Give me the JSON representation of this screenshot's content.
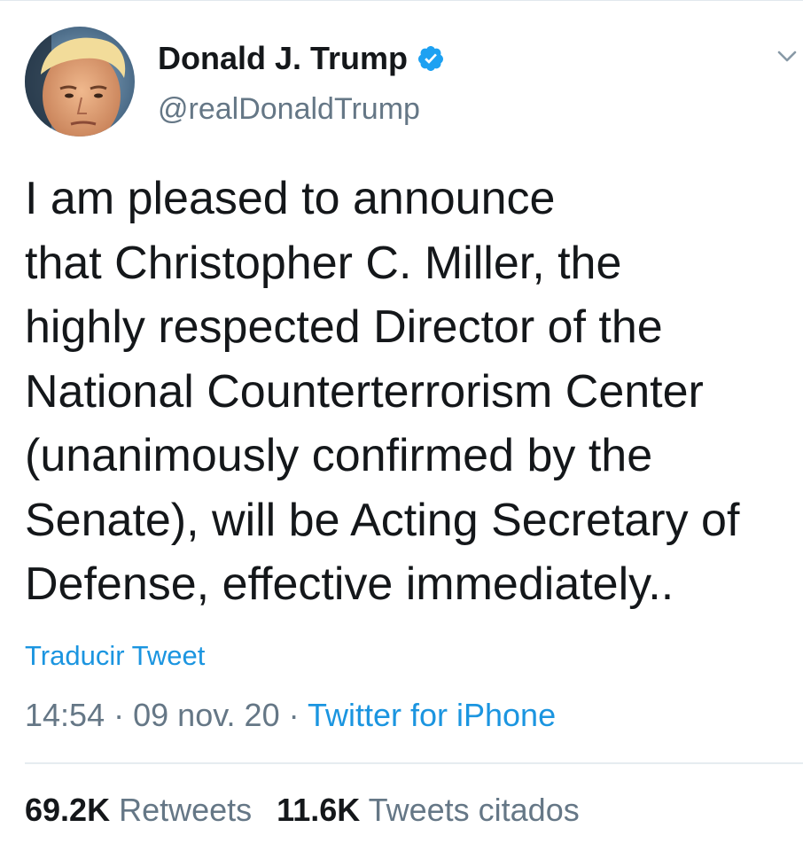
{
  "author": {
    "display_name": "Donald J. Trump",
    "handle": "@realDonaldTrump",
    "verified": true,
    "avatar_icon": "profile-photo"
  },
  "tweet": {
    "lines": [
      "I am pleased to announce",
      "that Christopher C. Miller, the",
      "highly respected Director of the",
      "National Counterterrorism Center",
      "(unanimously confirmed by the",
      "Senate), will be Acting Secretary of",
      "Defense, effective immediately.."
    ]
  },
  "translate_label": "Traducir Tweet",
  "meta": {
    "time": "14:54",
    "separator": "·",
    "date": "09 nov. 20",
    "source": "Twitter for iPhone"
  },
  "stats": {
    "retweets_count": "69.2K",
    "retweets_label": "Retweets",
    "quotes_count": "11.6K",
    "quotes_label": "Tweets citados"
  },
  "colors": {
    "link": "#1b95e0",
    "secondary_text": "#657786",
    "primary_text": "#14171a",
    "verified_badge": "#1da1f2"
  },
  "icons": {
    "verified": "verified-badge-icon",
    "more": "chevron-down-icon"
  }
}
